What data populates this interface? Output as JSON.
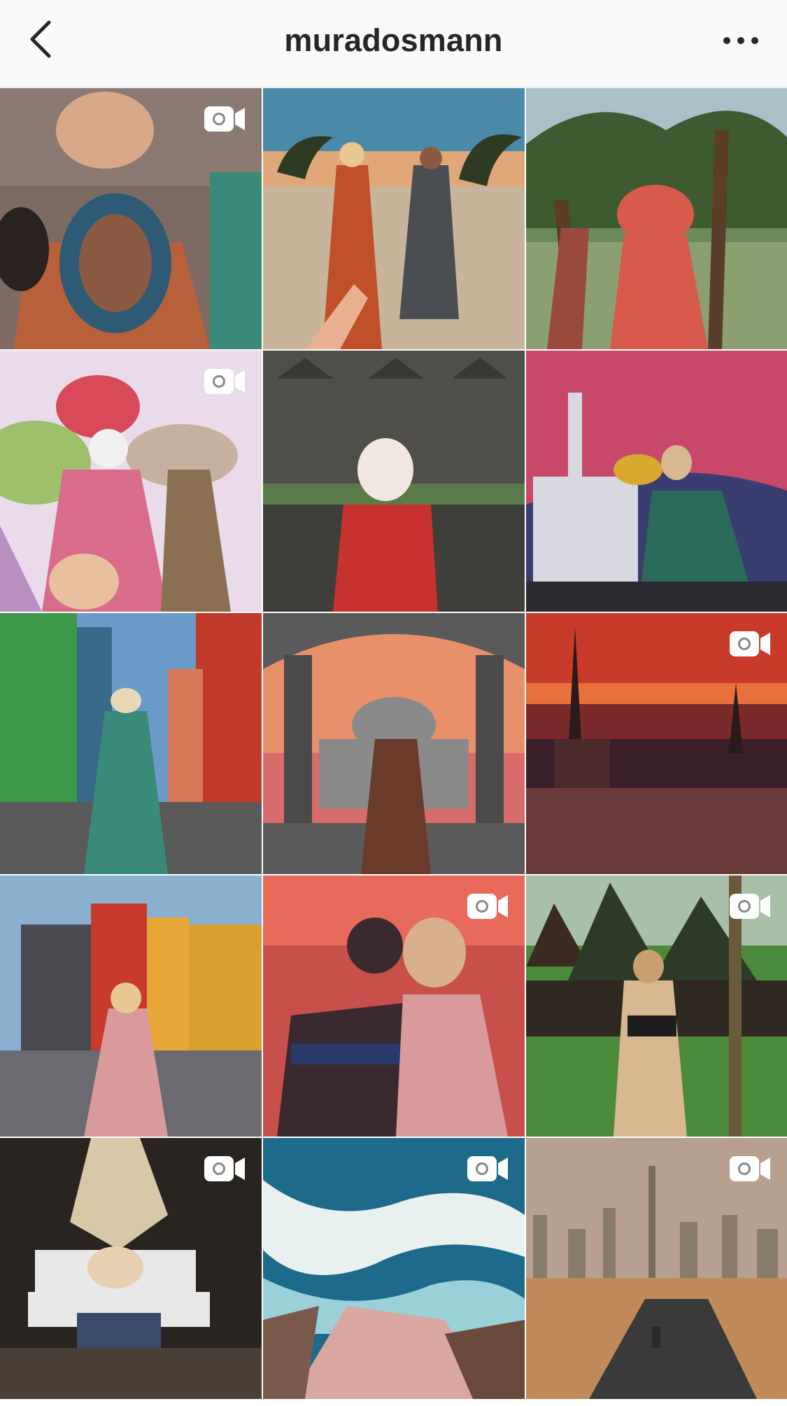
{
  "header": {
    "title": "muradosmann",
    "back_icon": "chevron-left-icon",
    "more_icon": "more-horizontal-icon"
  },
  "grid": {
    "posts": [
      {
        "id": "p1",
        "video": true,
        "colors": [
          "#7d6a62",
          "#b8603a",
          "#2f5a75"
        ]
      },
      {
        "id": "p2",
        "video": false,
        "colors": [
          "#4a8aa8",
          "#c8b49a",
          "#c0502a"
        ]
      },
      {
        "id": "p3",
        "video": false,
        "colors": [
          "#8aa070",
          "#3d5a30",
          "#d85a4a"
        ]
      },
      {
        "id": "p4",
        "video": true,
        "colors": [
          "#e9dbe9",
          "#d86c8a",
          "#9ec06a"
        ]
      },
      {
        "id": "p5",
        "video": false,
        "colors": [
          "#6a6a66",
          "#403e3a",
          "#c8322e"
        ]
      },
      {
        "id": "p6",
        "video": false,
        "colors": [
          "#3a3d70",
          "#c8486a",
          "#2a6a5a"
        ]
      },
      {
        "id": "p7",
        "video": false,
        "colors": [
          "#6a9ac8",
          "#3a9a4a",
          "#c03a2a"
        ]
      },
      {
        "id": "p8",
        "video": false,
        "colors": [
          "#d86c6a",
          "#8a8a8a",
          "#5a5a5a"
        ]
      },
      {
        "id": "p9",
        "video": true,
        "colors": [
          "#c83a2a",
          "#7a2a2a",
          "#3a1e2a"
        ]
      },
      {
        "id": "p10",
        "video": false,
        "colors": [
          "#8ab0d0",
          "#c83a2e",
          "#e8a838"
        ]
      },
      {
        "id": "p11",
        "video": true,
        "colors": [
          "#e86a5a",
          "#3a2a30",
          "#d89a9a"
        ]
      },
      {
        "id": "p12",
        "video": true,
        "colors": [
          "#a8c0a8",
          "#2e3a28",
          "#4a8a3a"
        ]
      },
      {
        "id": "p13",
        "video": true,
        "colors": [
          "#2a2420",
          "#e8e8e8",
          "#3a4a6a"
        ]
      },
      {
        "id": "p14",
        "video": true,
        "colors": [
          "#1e6a8a",
          "#e8f0f0",
          "#d8a8a0"
        ]
      },
      {
        "id": "p15",
        "video": true,
        "colors": [
          "#b8a090",
          "#8a7a6a",
          "#c08a5a"
        ]
      }
    ]
  }
}
